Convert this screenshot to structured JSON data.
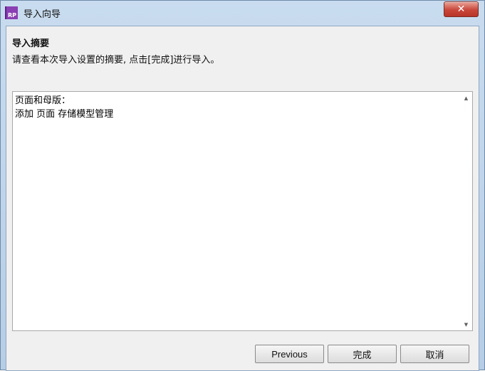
{
  "window": {
    "title": "导入向导",
    "icon_label": "RP",
    "close_glyph": "✕"
  },
  "header": {
    "title": "导入摘要",
    "description": "请查看本次导入设置的摘要, 点击[完成]进行导入。"
  },
  "summary": {
    "lines": "页面和母版：\n添加 页面 存储模型管理"
  },
  "scrollbar": {
    "up_glyph": "▲",
    "down_glyph": "▼"
  },
  "buttons": {
    "previous": "Previous",
    "finish": "完成",
    "cancel": "取消"
  }
}
